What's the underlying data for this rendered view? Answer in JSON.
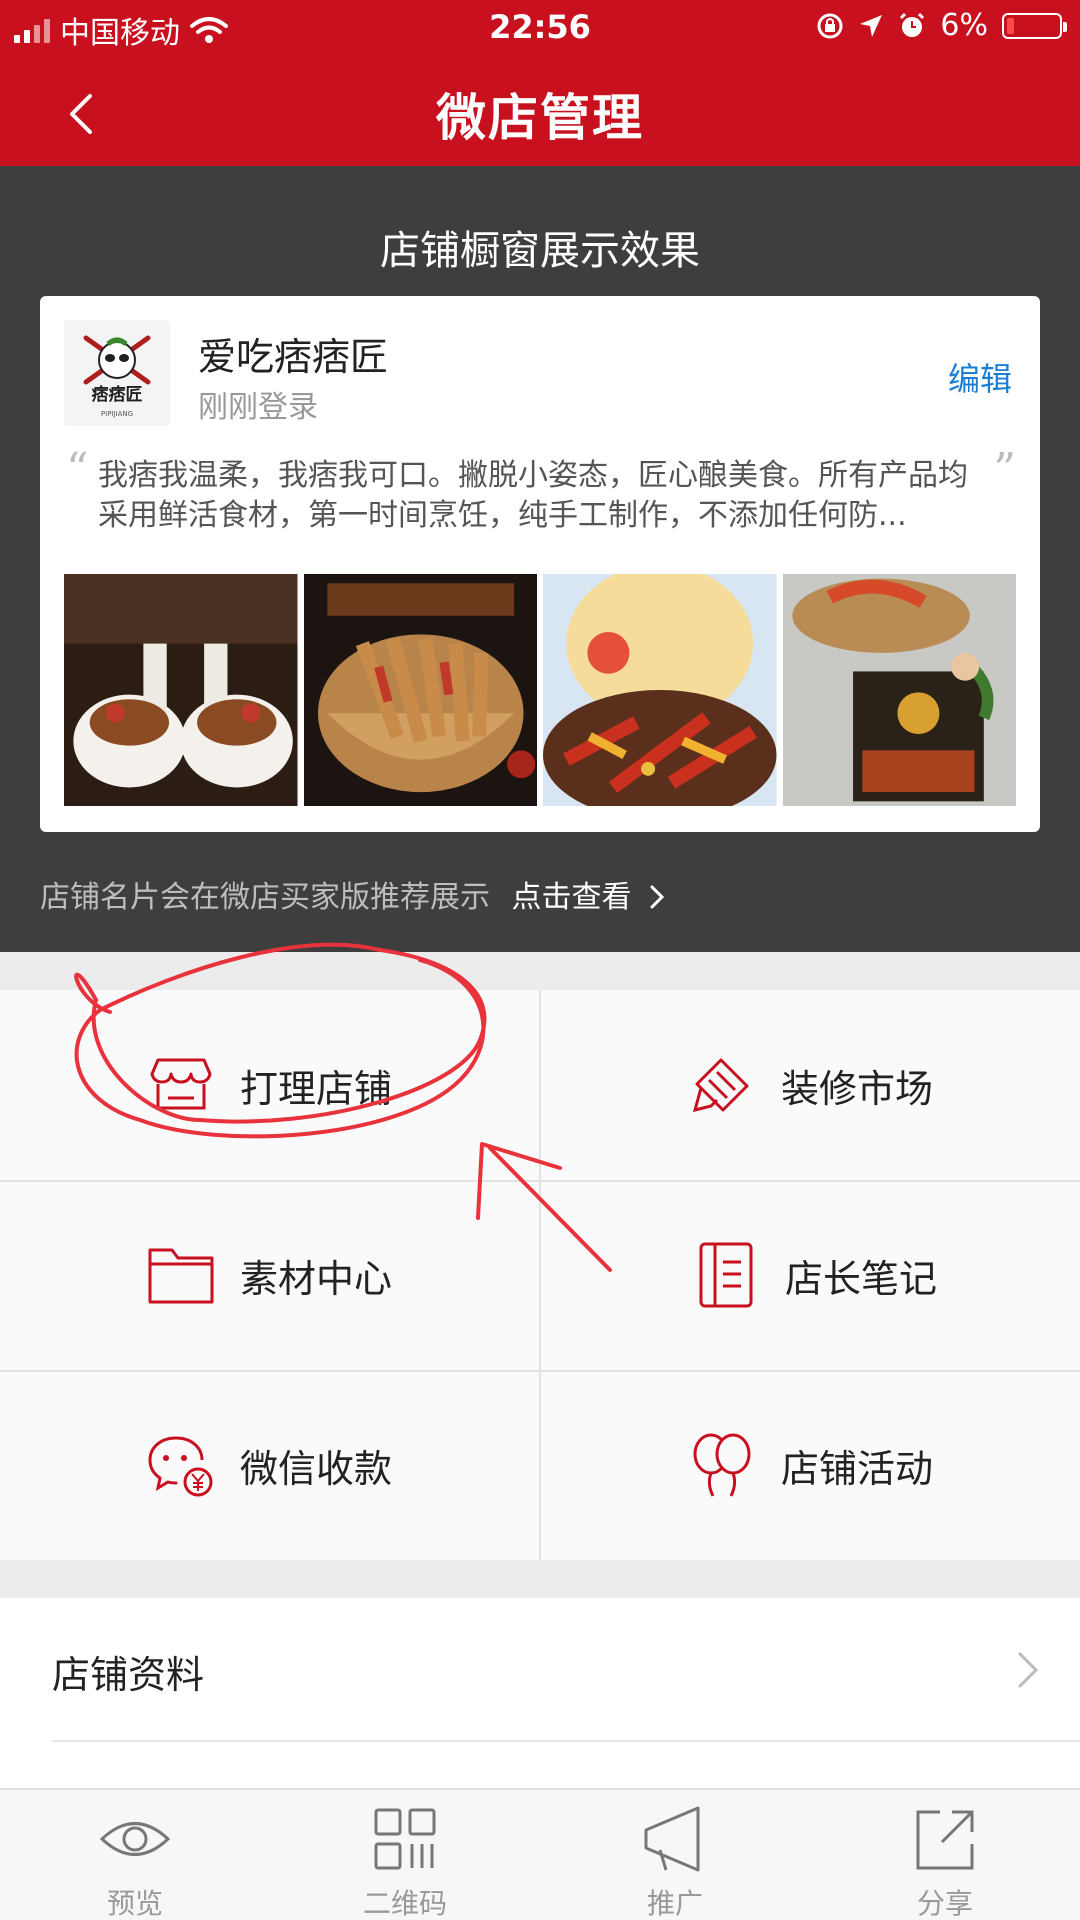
{
  "status_bar": {
    "carrier": "中国移动",
    "time": "22:56",
    "battery": "6%",
    "battery_level": 0.06
  },
  "nav": {
    "title": "微店管理",
    "back_icon": "chevron-left-icon"
  },
  "showcase": {
    "title": "店铺橱窗展示效果",
    "shop_name": "爱吃痞痞匠",
    "login_status": "刚刚登录",
    "edit_label": "编辑",
    "logo_text": "痞痞匠",
    "logo_subtext": "PIPIJIANG",
    "description": "我痞我温柔，我痞我可口。撇脱小姿态，匠心酿美食。所有产品均采用鲜活食材，第一时间烹饪，纯手工制作，不添加任何防...",
    "footer_text": "店铺名片会在微店买家版推荐展示",
    "footer_link": "点击查看"
  },
  "grid": [
    {
      "label": "打理店铺",
      "icon": "storefront-icon"
    },
    {
      "label": "装修市场",
      "icon": "paint-brush-icon"
    },
    {
      "label": "素材中心",
      "icon": "folder-icon"
    },
    {
      "label": "店长笔记",
      "icon": "notebook-icon"
    },
    {
      "label": "微信收款",
      "icon": "wechat-pay-icon"
    },
    {
      "label": "店铺活动",
      "icon": "balloons-icon"
    }
  ],
  "list": {
    "shop_info": "店铺资料"
  },
  "tabbar": [
    {
      "label": "预览",
      "icon": "eye-icon"
    },
    {
      "label": "二维码",
      "icon": "qr-code-icon"
    },
    {
      "label": "推广",
      "icon": "megaphone-icon"
    },
    {
      "label": "分享",
      "icon": "share-icon"
    }
  ],
  "colors": {
    "brand_red": "#c8101f",
    "dark_panel": "#3e3e3e",
    "link_blue": "#1a7fd4",
    "annotation_red": "#e8323c"
  }
}
